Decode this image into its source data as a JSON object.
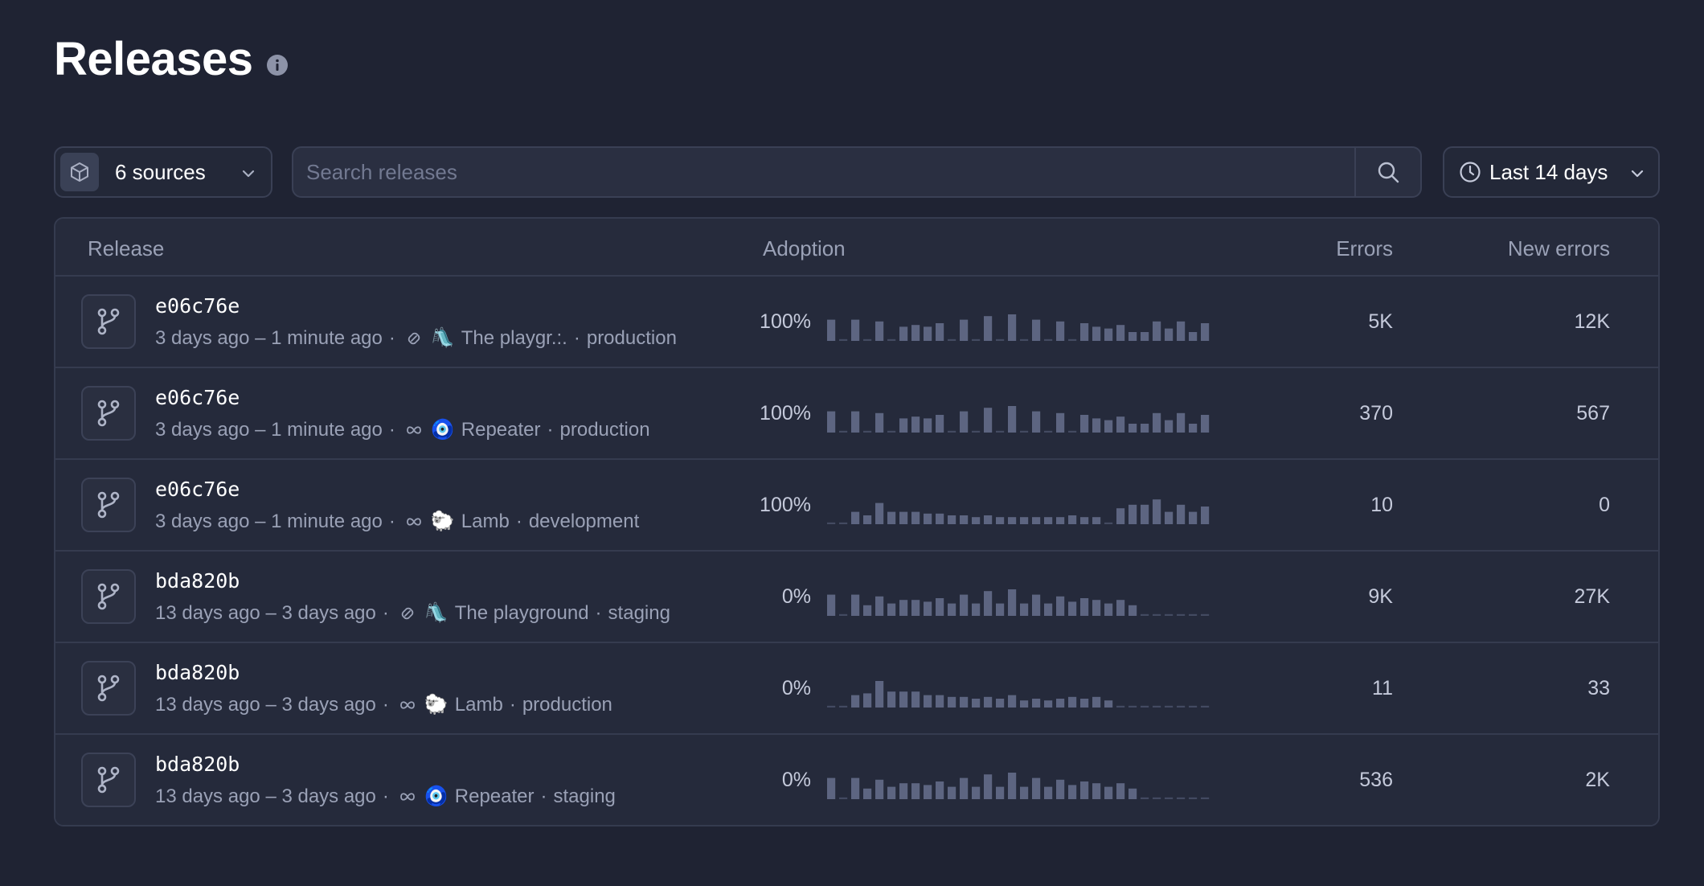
{
  "page": {
    "title": "Releases"
  },
  "toolbar": {
    "sources_label": "6 sources",
    "search_placeholder": "Search releases",
    "range_label": "Last 14 days"
  },
  "table": {
    "headers": {
      "release": "Release",
      "adoption": "Adoption",
      "errors": "Errors",
      "new_errors": "New errors"
    },
    "rows": [
      {
        "version": "e06c76e",
        "time": "3 days ago – 1 minute ago",
        "source_icon": "link-chain-icon",
        "emoji": "🛝",
        "project": "The playgr.:.",
        "environment": "production",
        "adoption": "100%",
        "errors": "5K",
        "new_errors": "12K",
        "series": [
          0.6,
          0.05,
          0.6,
          0.05,
          0.55,
          0.05,
          0.4,
          0.45,
          0.4,
          0.5,
          0.05,
          0.6,
          0.05,
          0.7,
          0.05,
          0.75,
          0.05,
          0.6,
          0.05,
          0.55,
          0.05,
          0.5,
          0.4,
          0.35,
          0.45,
          0.25,
          0.25,
          0.55,
          0.35,
          0.55,
          0.25,
          0.5
        ]
      },
      {
        "version": "e06c76e",
        "time": "3 days ago – 1 minute ago",
        "source_icon": "infinity-icon",
        "emoji": "🧿",
        "project": "Repeater",
        "environment": "production",
        "adoption": "100%",
        "errors": "370",
        "new_errors": "567",
        "series": [
          0.6,
          0.05,
          0.6,
          0.05,
          0.55,
          0.05,
          0.4,
          0.45,
          0.4,
          0.5,
          0.05,
          0.6,
          0.05,
          0.7,
          0.05,
          0.75,
          0.05,
          0.6,
          0.05,
          0.55,
          0.05,
          0.5,
          0.4,
          0.35,
          0.45,
          0.25,
          0.25,
          0.55,
          0.35,
          0.55,
          0.25,
          0.5
        ]
      },
      {
        "version": "e06c76e",
        "time": "3 days ago – 1 minute ago",
        "source_icon": "infinity-icon",
        "emoji": "🐑",
        "project": "Lamb",
        "environment": "development",
        "adoption": "100%",
        "errors": "10",
        "new_errors": "0",
        "series": [
          0.05,
          0.05,
          0.35,
          0.25,
          0.6,
          0.35,
          0.35,
          0.35,
          0.3,
          0.3,
          0.25,
          0.25,
          0.2,
          0.25,
          0.2,
          0.2,
          0.2,
          0.2,
          0.2,
          0.2,
          0.25,
          0.2,
          0.2,
          0.05,
          0.45,
          0.55,
          0.55,
          0.7,
          0.35,
          0.55,
          0.35,
          0.5
        ]
      },
      {
        "version": "bda820b",
        "time": "13 days ago – 3 days ago",
        "source_icon": "link-chain-icon",
        "emoji": "🛝",
        "project": "The playground",
        "environment": "staging",
        "adoption": "0%",
        "errors": "9K",
        "new_errors": "27K",
        "series": [
          0.6,
          0.05,
          0.6,
          0.3,
          0.55,
          0.35,
          0.45,
          0.45,
          0.4,
          0.5,
          0.35,
          0.6,
          0.35,
          0.7,
          0.35,
          0.75,
          0.35,
          0.6,
          0.35,
          0.55,
          0.4,
          0.5,
          0.45,
          0.35,
          0.45,
          0.3,
          0.05,
          0.05,
          0.05,
          0.05,
          0.05,
          0.05
        ]
      },
      {
        "version": "bda820b",
        "time": "13 days ago – 3 days ago",
        "source_icon": "infinity-icon",
        "emoji": "🐑",
        "project": "Lamb",
        "environment": "production",
        "adoption": "0%",
        "errors": "11",
        "new_errors": "33",
        "series": [
          0.05,
          0.05,
          0.35,
          0.4,
          0.75,
          0.45,
          0.45,
          0.45,
          0.35,
          0.35,
          0.3,
          0.3,
          0.25,
          0.3,
          0.25,
          0.35,
          0.2,
          0.25,
          0.2,
          0.25,
          0.3,
          0.25,
          0.3,
          0.2,
          0.05,
          0.05,
          0.05,
          0.05,
          0.05,
          0.05,
          0.05,
          0.05
        ]
      },
      {
        "version": "bda820b",
        "time": "13 days ago – 3 days ago",
        "source_icon": "infinity-icon",
        "emoji": "🧿",
        "project": "Repeater",
        "environment": "staging",
        "adoption": "0%",
        "errors": "536",
        "new_errors": "2K",
        "series": [
          0.6,
          0.05,
          0.6,
          0.3,
          0.55,
          0.35,
          0.45,
          0.45,
          0.4,
          0.5,
          0.35,
          0.6,
          0.35,
          0.7,
          0.35,
          0.75,
          0.35,
          0.6,
          0.35,
          0.55,
          0.4,
          0.5,
          0.45,
          0.35,
          0.45,
          0.3,
          0.05,
          0.05,
          0.05,
          0.05,
          0.05,
          0.05
        ]
      }
    ]
  },
  "colors": {
    "background": "#1f2333",
    "bar": "#5d6581",
    "bar_dim": "#434a61"
  }
}
